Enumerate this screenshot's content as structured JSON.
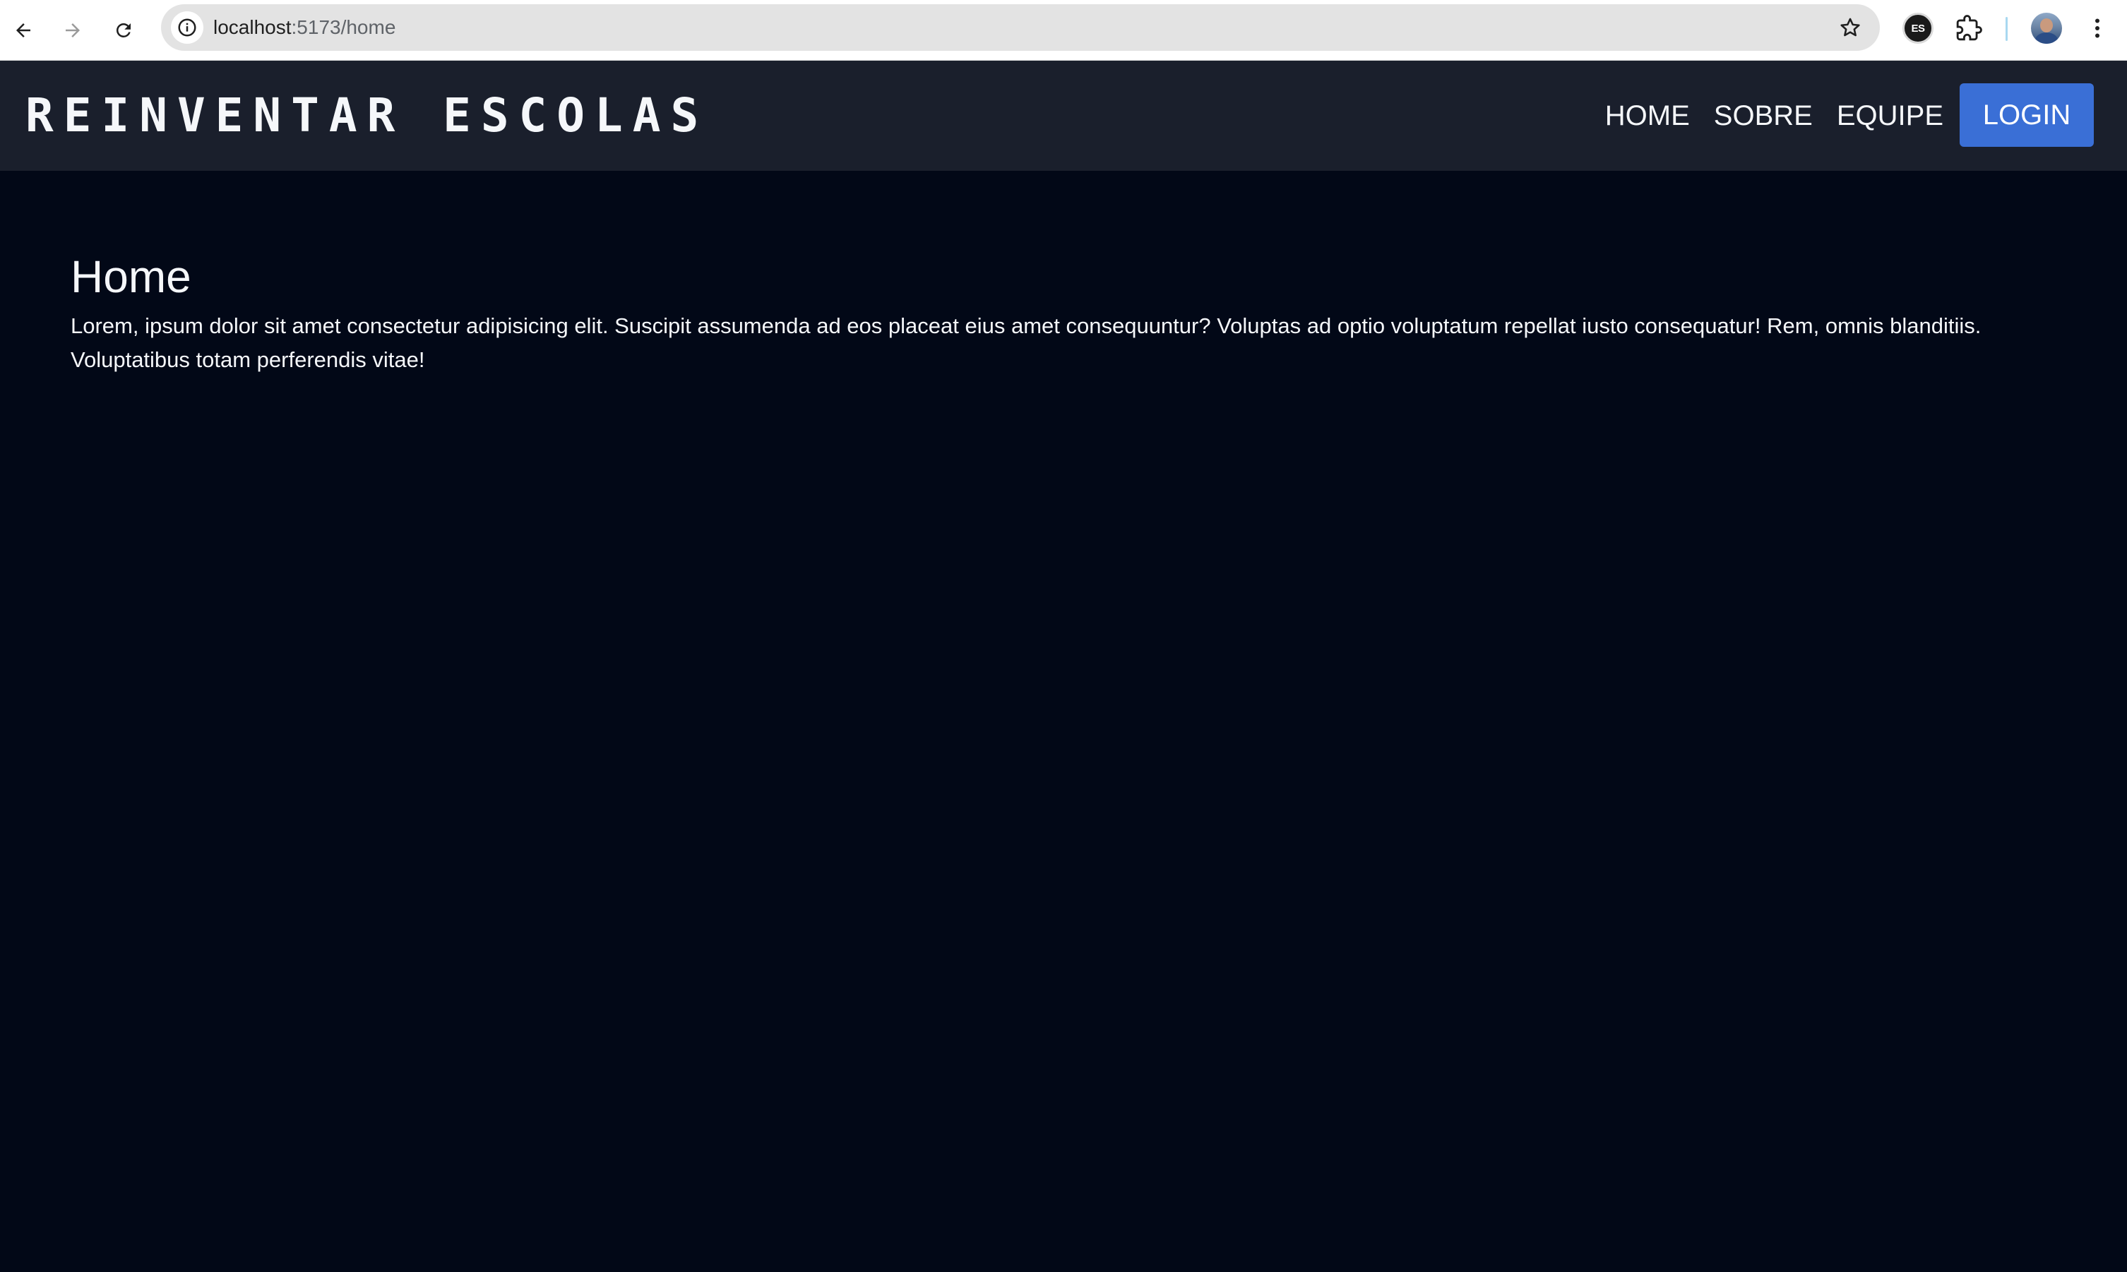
{
  "browser": {
    "url_host": "localhost",
    "url_path": ":5173/home",
    "extension_badge": "ES"
  },
  "navbar": {
    "brand": "REINVENTAR ESCOLAS",
    "links": [
      "HOME",
      "SOBRE",
      "EQUIPE"
    ],
    "login_label": "LOGIN"
  },
  "main": {
    "title": "Home",
    "body": "Lorem, ipsum dolor sit amet consectetur adipisicing elit. Suscipit assumenda ad eos placeat eius amet consequuntur? Voluptas ad optio voluptatum repellat iusto consequatur! Rem, omnis blanditiis. Voluptatibus totam perferendis vitae!"
  },
  "icons": {
    "back": "back-arrow-icon",
    "forward": "forward-arrow-icon",
    "reload": "reload-icon",
    "site_info": "info-icon",
    "bookmark": "star-icon",
    "extensions": "puzzle-icon",
    "menu": "kebab-menu-icon"
  },
  "colors": {
    "page_background": "#020817",
    "navbar_background": "#1a1f2c",
    "login_button": "#3a6fd6",
    "text": "#f5f7fa"
  }
}
